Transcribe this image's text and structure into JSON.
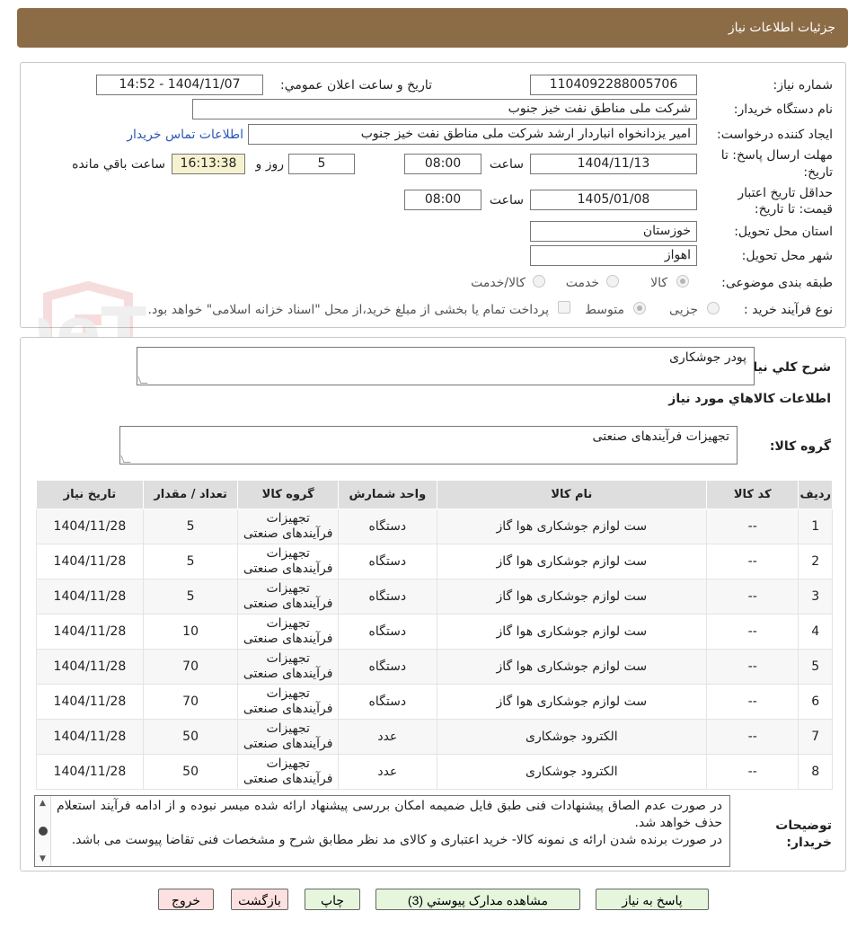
{
  "header": {
    "title": "جزئیات اطلاعات نیاز"
  },
  "form": {
    "need_number": {
      "label": "شماره نیاز:",
      "value": "1104092288005706"
    },
    "announce": {
      "label": "تاریخ و ساعت اعلان عمومي:",
      "value": "1404/11/07 - 14:52"
    },
    "buyer": {
      "label": "نام دستگاه خریدار:",
      "value": "شرکت ملی مناطق نفت خیز جنوب"
    },
    "requester": {
      "label": "ایجاد کننده درخواست:",
      "value": "امیر یزدانخواه انباردار ارشد شرکت ملی مناطق نفت خیز جنوب"
    },
    "contact_link": "اطلاعات تماس خریدار",
    "deadline": {
      "label_1": "مهلت ارسال پاسخ: تا",
      "label_2": "تاریخ:",
      "date": "1404/11/13",
      "time_label": "ساعت",
      "time": "08:00",
      "days": "5",
      "days_label": "روز و",
      "remaining": "16:13:38",
      "remaining_label": "ساعت باقي مانده"
    },
    "validity": {
      "label_1": "حداقل تاریخ اعتبار",
      "label_2": "قیمت: تا تاریخ:",
      "date": "1405/01/08",
      "time_label": "ساعت",
      "time": "08:00"
    },
    "province": {
      "label": "استان محل تحویل:",
      "value": "خوزستان"
    },
    "city": {
      "label": "شهر محل تحویل:",
      "value": "اهواز"
    },
    "category": {
      "label": "طبقه بندی موضوعی:",
      "options": [
        "کالا",
        "خدمت",
        "کالا/خدمت"
      ],
      "selected": "کالا"
    },
    "process": {
      "label": "نوع فرآیند خرید :",
      "options": [
        "جزیی",
        "متوسط"
      ],
      "selected": "متوسط",
      "payment_note": "پرداخت تمام یا بخشی از مبلغ خرید،از محل \"اسناد خزانه اسلامی\" خواهد بود."
    }
  },
  "watermark": "AriaTender.neT",
  "summary": {
    "label": "شرح کلي نیاز:",
    "value": "پودر جوشکاری",
    "goods_info_title": "اطلاعات کالاهاي مورد نیاز",
    "group_label": "گروه کالا:",
    "group_value": "تجهیزات فرآیندهای صنعتی"
  },
  "table": {
    "headers": [
      "ردیف",
      "کد کالا",
      "نام کالا",
      "واحد شمارش",
      "گروه کالا",
      "تعداد / مقدار",
      "تاریخ نیاز"
    ],
    "rows": [
      [
        "1",
        "--",
        "ست لوازم جوشکاری هوا گاز",
        "دستگاه",
        "تجهیزات فرآیندهای صنعتی",
        "5",
        "1404/11/28"
      ],
      [
        "2",
        "--",
        "ست لوازم جوشکاری هوا گاز",
        "دستگاه",
        "تجهیزات فرآیندهای صنعتی",
        "5",
        "1404/11/28"
      ],
      [
        "3",
        "--",
        "ست لوازم جوشکاری هوا گاز",
        "دستگاه",
        "تجهیزات فرآیندهای صنعتی",
        "5",
        "1404/11/28"
      ],
      [
        "4",
        "--",
        "ست لوازم جوشکاری هوا گاز",
        "دستگاه",
        "تجهیزات فرآیندهای صنعتی",
        "10",
        "1404/11/28"
      ],
      [
        "5",
        "--",
        "ست لوازم جوشکاری هوا گاز",
        "دستگاه",
        "تجهیزات فرآیندهای صنعتی",
        "70",
        "1404/11/28"
      ],
      [
        "6",
        "--",
        "ست لوازم جوشکاری هوا گاز",
        "دستگاه",
        "تجهیزات فرآیندهای صنعتی",
        "70",
        "1404/11/28"
      ],
      [
        "7",
        "--",
        "الکترود جوشکاری",
        "عدد",
        "تجهیزات فرآیندهای صنعتی",
        "50",
        "1404/11/28"
      ],
      [
        "8",
        "--",
        "الکترود جوشکاری",
        "عدد",
        "تجهیزات فرآیندهای صنعتی",
        "50",
        "1404/11/28"
      ]
    ]
  },
  "notes": {
    "label_1": "توضیحات",
    "label_2": "خریدار:",
    "text_1": "در صورت عدم الصاق پیشنهادات فنی طبق فایل ضمیمه امکان بررسی پیشنهاد ارائه شده میسر نبوده و از ادامه فرآیند استعلام حذف خواهد شد.",
    "text_2": "در صورت برنده شدن ارائه ی نمونه کالا- خرید اعتباری و کالای مد نظر مطابق شرح و مشخصات فنی تقاضا پیوست می باشد."
  },
  "buttons": {
    "reply": "پاسخ به نیاز",
    "attachments": "مشاهده مدارک پیوستي (3)",
    "print": "چاپ",
    "back": "بازگشت",
    "exit": "خروج"
  }
}
